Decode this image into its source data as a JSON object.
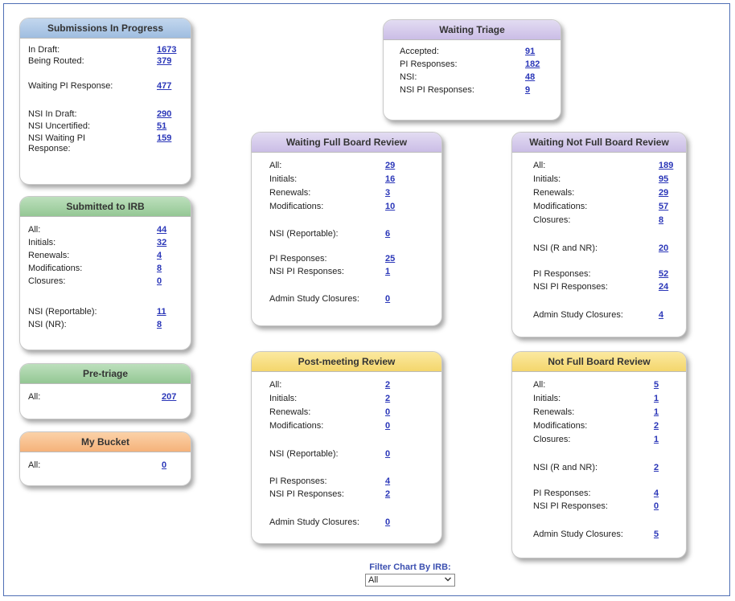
{
  "cards": {
    "submissions": {
      "title": "Submissions In Progress",
      "rows": [
        {
          "label": "In Draft:",
          "value": "1673"
        },
        {
          "label": "Being Routed:",
          "value": "379"
        },
        {
          "label": "Waiting PI Response:",
          "value": "477"
        },
        {
          "label": "NSI In Draft:",
          "value": "290"
        },
        {
          "label": "NSI Uncertified:",
          "value": "51"
        },
        {
          "label": "NSI Waiting PI",
          "label2": "Response:",
          "value": "159"
        }
      ]
    },
    "submitted": {
      "title": "Submitted to IRB",
      "rows": [
        {
          "label": "All:",
          "value": "44"
        },
        {
          "label": "Initials:",
          "value": "32"
        },
        {
          "label": "Renewals:",
          "value": "4"
        },
        {
          "label": "Modifications:",
          "value": "8"
        },
        {
          "label": "Closures:",
          "value": "0"
        },
        {
          "label": "NSI (Reportable):",
          "value": "11"
        },
        {
          "label": "NSI (NR):",
          "value": "8"
        }
      ]
    },
    "pretriage": {
      "title": "Pre-triage",
      "rows": [
        {
          "label": "All:",
          "value": "207"
        }
      ]
    },
    "mybucket": {
      "title": "My Bucket",
      "rows": [
        {
          "label": "All:",
          "value": "0"
        }
      ]
    },
    "triage": {
      "title": "Waiting Triage",
      "rows": [
        {
          "label": "Accepted:",
          "value": "91"
        },
        {
          "label": "PI Responses:",
          "value": "182"
        },
        {
          "label": "NSI:",
          "value": "48"
        },
        {
          "label": "NSI PI Responses:",
          "value": "9"
        }
      ]
    },
    "fullboard": {
      "title": "Waiting Full Board Review",
      "rows": [
        {
          "label": "All:",
          "value": "29"
        },
        {
          "label": "Initials:",
          "value": "16"
        },
        {
          "label": "Renewals:",
          "value": "3"
        },
        {
          "label": "Modifications:",
          "value": "10"
        },
        {
          "label": "NSI (Reportable):",
          "value": "6"
        },
        {
          "label": "PI Responses:",
          "value": "25"
        },
        {
          "label": "NSI PI Responses:",
          "value": "1"
        },
        {
          "label": "Admin Study Closures:",
          "value": "0"
        }
      ]
    },
    "notfull": {
      "title": "Waiting Not Full Board Review",
      "rows": [
        {
          "label": "All:",
          "value": "189"
        },
        {
          "label": "Initials:",
          "value": "95"
        },
        {
          "label": "Renewals:",
          "value": "29"
        },
        {
          "label": "Modifications:",
          "value": "57"
        },
        {
          "label": "Closures:",
          "value": "8"
        },
        {
          "label": "NSI (R and NR):",
          "value": "20"
        },
        {
          "label": "PI Responses:",
          "value": "52"
        },
        {
          "label": "NSI PI Responses:",
          "value": "24"
        },
        {
          "label": "Admin Study Closures:",
          "value": "4"
        }
      ]
    },
    "postmeeting": {
      "title": "Post-meeting Review",
      "rows": [
        {
          "label": "All:",
          "value": "2"
        },
        {
          "label": "Initials:",
          "value": "2"
        },
        {
          "label": "Renewals:",
          "value": "0"
        },
        {
          "label": "Modifications:",
          "value": "0"
        },
        {
          "label": "NSI (Reportable):",
          "value": "0"
        },
        {
          "label": "PI Responses:",
          "value": "4"
        },
        {
          "label": "NSI PI Responses:",
          "value": "2"
        },
        {
          "label": "Admin Study Closures:",
          "value": "0"
        }
      ]
    },
    "notfullboard": {
      "title": "Not Full Board Review",
      "rows": [
        {
          "label": "All:",
          "value": "5"
        },
        {
          "label": "Initials:",
          "value": "1"
        },
        {
          "label": "Renewals:",
          "value": "1"
        },
        {
          "label": "Modifications:",
          "value": "2"
        },
        {
          "label": "Closures:",
          "value": "1"
        },
        {
          "label": "NSI (R and NR):",
          "value": "2"
        },
        {
          "label": "PI Responses:",
          "value": "4"
        },
        {
          "label": "NSI PI Responses:",
          "value": "0"
        },
        {
          "label": "Admin Study Closures:",
          "value": "5"
        }
      ]
    }
  },
  "filter": {
    "label": "Filter Chart By IRB:",
    "selected": "All"
  }
}
